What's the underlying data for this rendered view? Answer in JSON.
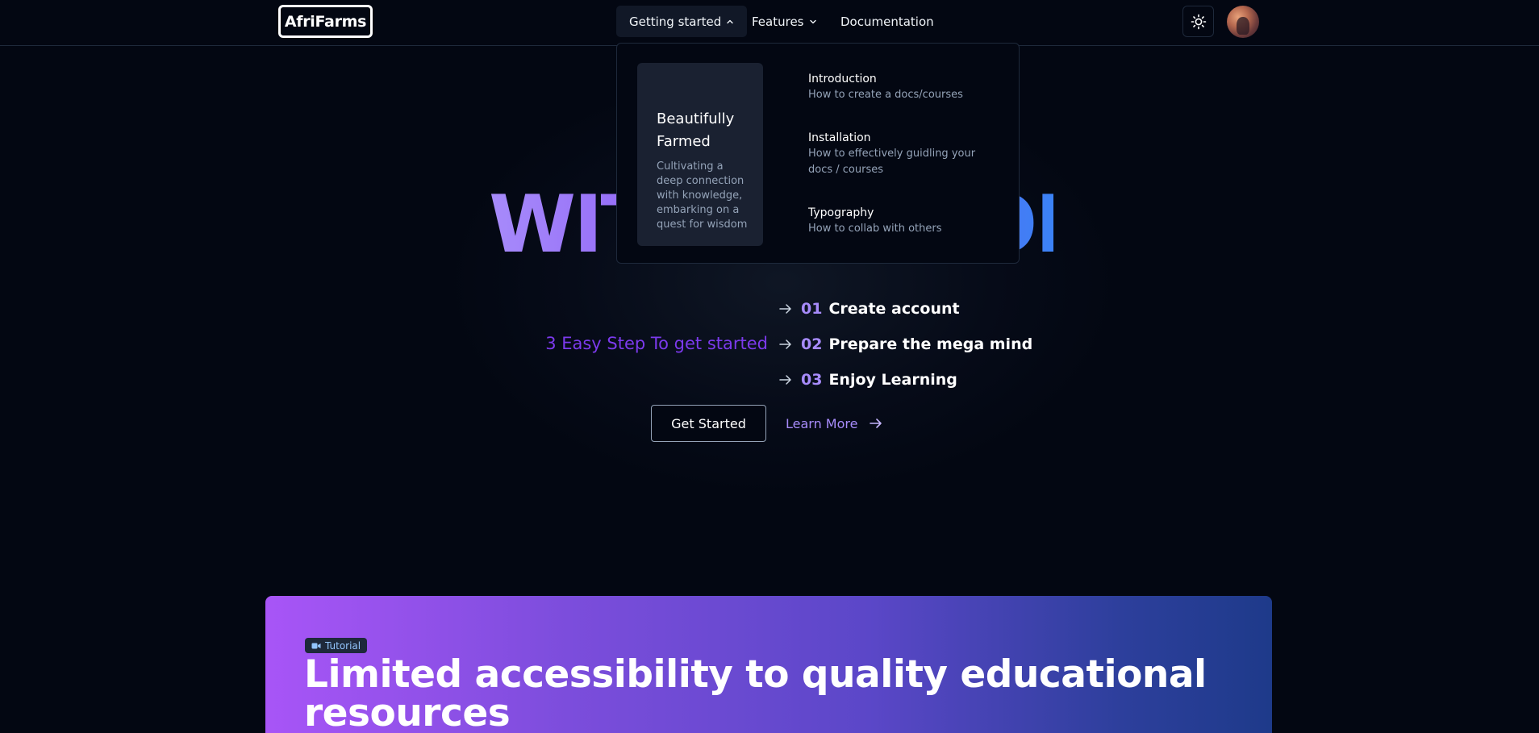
{
  "header": {
    "logo": "AfriFarms",
    "nav": [
      {
        "label": "Getting started",
        "has_dropdown": true,
        "expanded": true
      },
      {
        "label": "Features",
        "has_dropdown": true,
        "expanded": false
      },
      {
        "label": "Documentation",
        "has_dropdown": false
      }
    ],
    "theme_icon": "sun-icon"
  },
  "dropdown": {
    "feature": {
      "title": "Beautifully Farmed",
      "description": "Cultivating a deep connection with knowledge, embarking on a quest for wisdom"
    },
    "links": [
      {
        "title": "Introduction",
        "description": "How to create a docs/courses"
      },
      {
        "title": "Installation",
        "description": "How to effectively guidling your docs / courses"
      },
      {
        "title": "Typography",
        "description": "How to collab with others"
      }
    ]
  },
  "hero": {
    "title": "WITH WISDOM",
    "steps_label": "3 Easy Step To get started",
    "steps": [
      {
        "num": "01",
        "text": "Create account"
      },
      {
        "num": "02",
        "text": "Prepare the mega mind"
      },
      {
        "num": "03",
        "text": "Enjoy Learning"
      }
    ],
    "primary_button": "Get Started",
    "secondary_button": "Learn More"
  },
  "banner": {
    "badge": "Tutorial",
    "title": "Limited accessibility to quality educational resources"
  },
  "colors": {
    "background": "#030712",
    "accent_purple": "#a78bfa",
    "accent_violet": "#7c3aed",
    "gradient_start": "#a855f7",
    "gradient_end": "#1e3a8a"
  }
}
